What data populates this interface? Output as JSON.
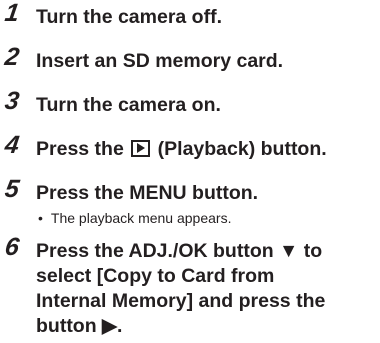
{
  "steps": [
    {
      "number": "1",
      "text": "Turn the camera off."
    },
    {
      "number": "2",
      "text": "Insert an SD memory card."
    },
    {
      "number": "3",
      "text": "Turn the camera on."
    },
    {
      "number": "4",
      "text_before": "Press the",
      "icon": "playback-icon",
      "text_after": "(Playback) button."
    },
    {
      "number": "5",
      "text": "Press the MENU button.",
      "bullet": "•",
      "note": "The playback menu appears."
    },
    {
      "number": "6",
      "lines": [
        "Press the ADJ./OK button ▼ to",
        "select [Copy to Card from",
        "Internal Memory] and press the",
        "button ▶."
      ]
    }
  ]
}
